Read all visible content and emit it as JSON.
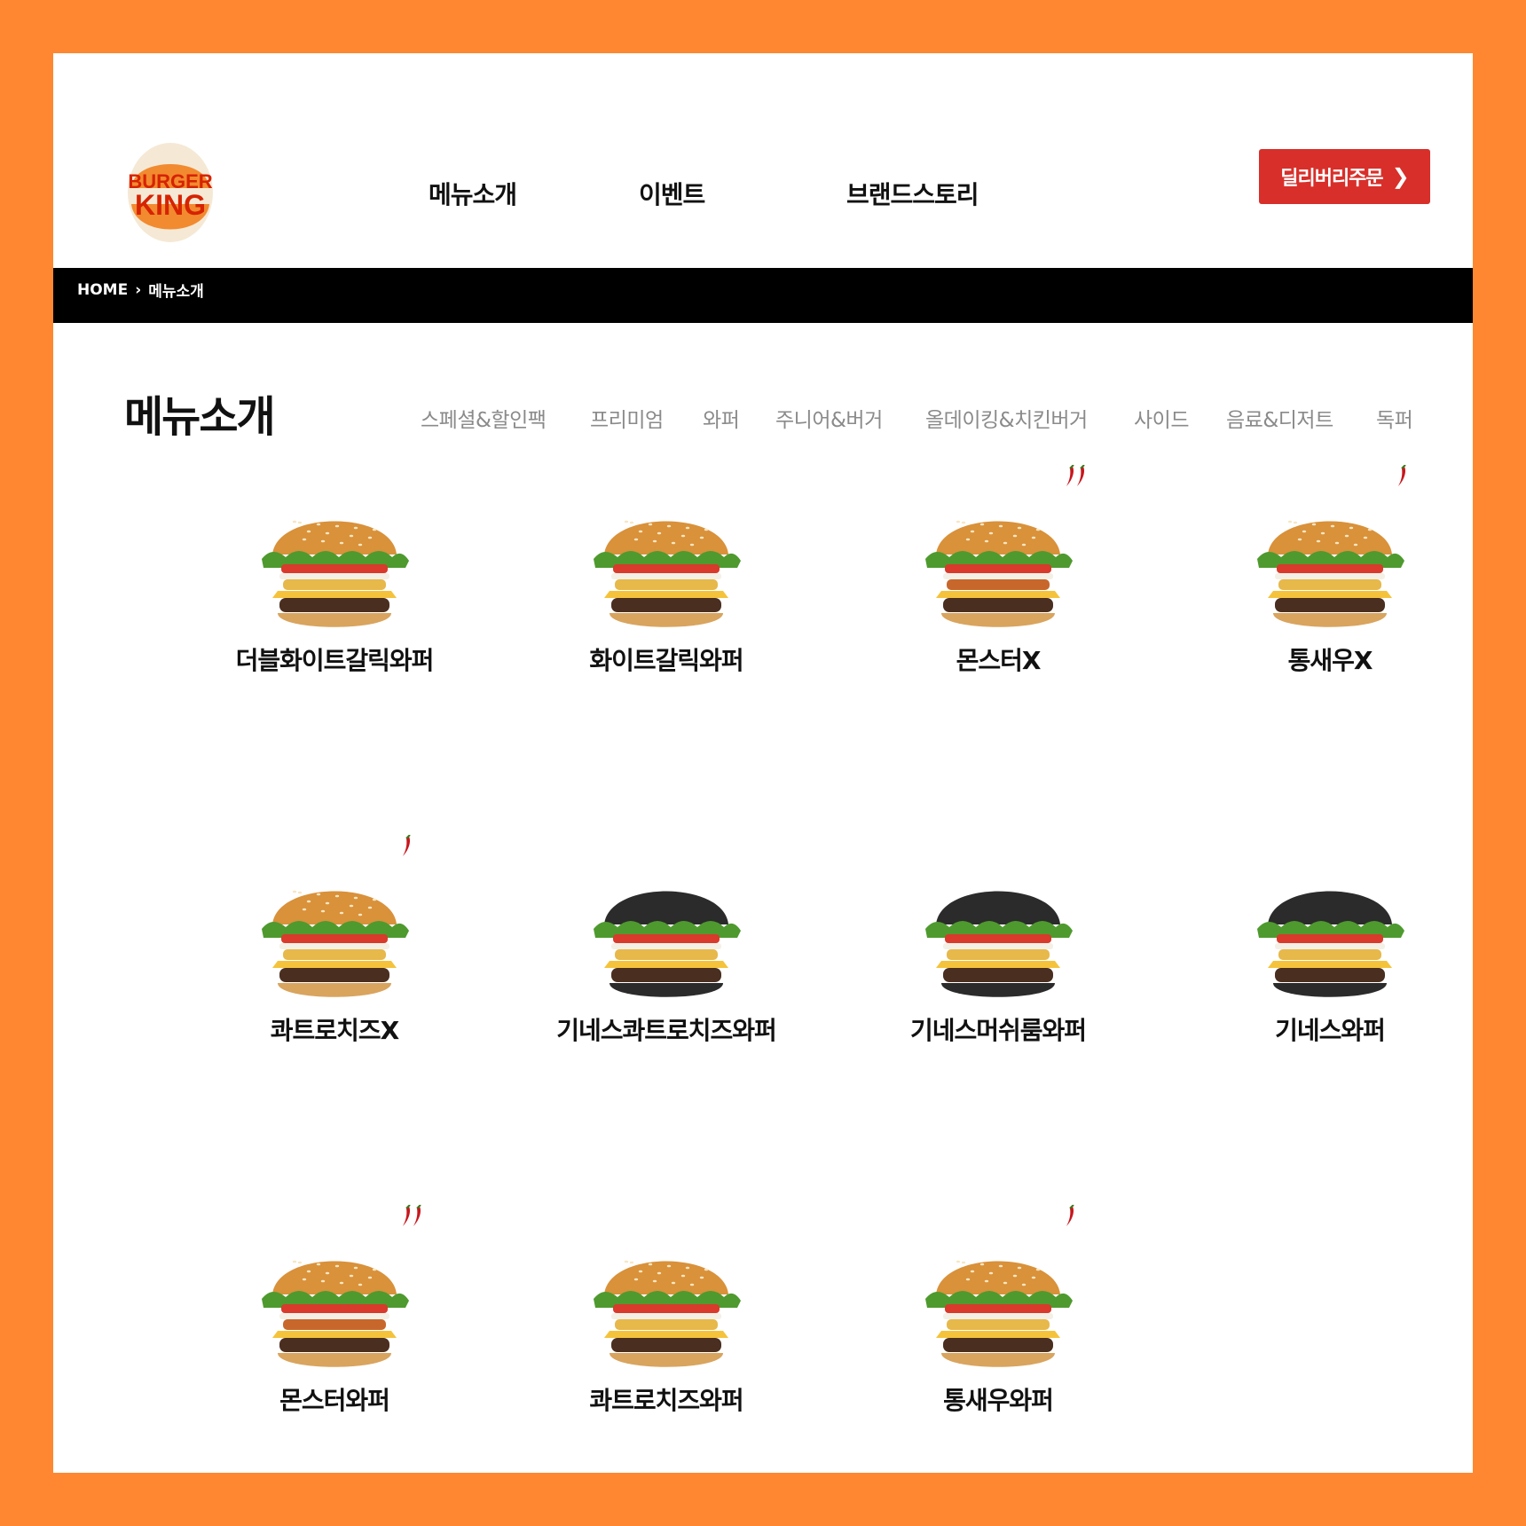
{
  "header": {
    "logo_text_1": "BURGER",
    "logo_text_2": "KING",
    "nav": [
      "메뉴소개",
      "이벤트",
      "브랜드스토리"
    ],
    "delivery_label": "딜리버리주문"
  },
  "breadcrumb": {
    "home": "HOME",
    "sep": "›",
    "current": "메뉴소개"
  },
  "page_title": "메뉴소개",
  "tabs": [
    "스페셜&할인팩",
    "프리미엄",
    "와퍼",
    "주니어&버거",
    "올데이킹&치킨버거",
    "사이드",
    "음료&디저트",
    "독퍼"
  ],
  "menu": [
    {
      "name": "더블화이트갈릭와퍼",
      "spice": 0,
      "bun": "sesame"
    },
    {
      "name": "화이트갈릭와퍼",
      "spice": 0,
      "bun": "sesame"
    },
    {
      "name": "몬스터X",
      "spice": 2,
      "bun": "sesame"
    },
    {
      "name": "통새우X",
      "spice": 1,
      "bun": "sesame"
    },
    {
      "name": "콰트로치즈X",
      "spice": 1,
      "bun": "sesame"
    },
    {
      "name": "기네스콰트로치즈와퍼",
      "spice": 0,
      "bun": "black"
    },
    {
      "name": "기네스머쉬룸와퍼",
      "spice": 0,
      "bun": "black"
    },
    {
      "name": "기네스와퍼",
      "spice": 0,
      "bun": "black"
    },
    {
      "name": "몬스터와퍼",
      "spice": 2,
      "bun": "sesame"
    },
    {
      "name": "콰트로치즈와퍼",
      "spice": 0,
      "bun": "sesame"
    },
    {
      "name": "통새우와퍼",
      "spice": 1,
      "bun": "sesame"
    }
  ],
  "colors": {
    "border": "#FF8732",
    "brand_red": "#D82F2A",
    "logo_orange": "#F5A623",
    "tab_gray": "#8a8a8a"
  }
}
